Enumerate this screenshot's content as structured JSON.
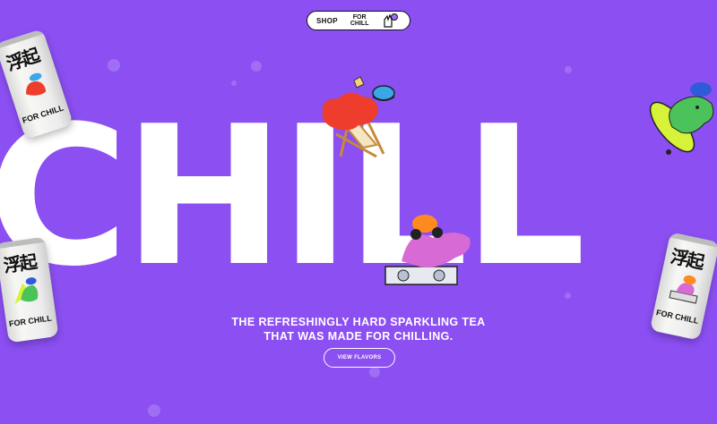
{
  "nav": {
    "shop_label": "SHOP",
    "logo_line1": "FOR",
    "logo_line2": "CHILL"
  },
  "hero": {
    "big_word": "CHILL",
    "tagline_line1": "THE REFRESHINGLY HARD SPARKLING TEA",
    "tagline_line2": "THAT WAS MADE FOR CHILLING.",
    "cta_label": "VIEW FLAVORS"
  },
  "can": {
    "kanji": "浮起",
    "brand": "FOR CHILL"
  },
  "colors": {
    "background": "#8b4ff2",
    "text": "#ffffff",
    "char_red": "#ee3d2c",
    "char_pink": "#d86ad6",
    "char_green": "#4cc25a",
    "skate_yellow": "#d6f33a",
    "hat_orange": "#ff8a1f",
    "hat_blue": "#3aa7e8"
  },
  "icons": {
    "nav": "hand-peace-icon"
  }
}
